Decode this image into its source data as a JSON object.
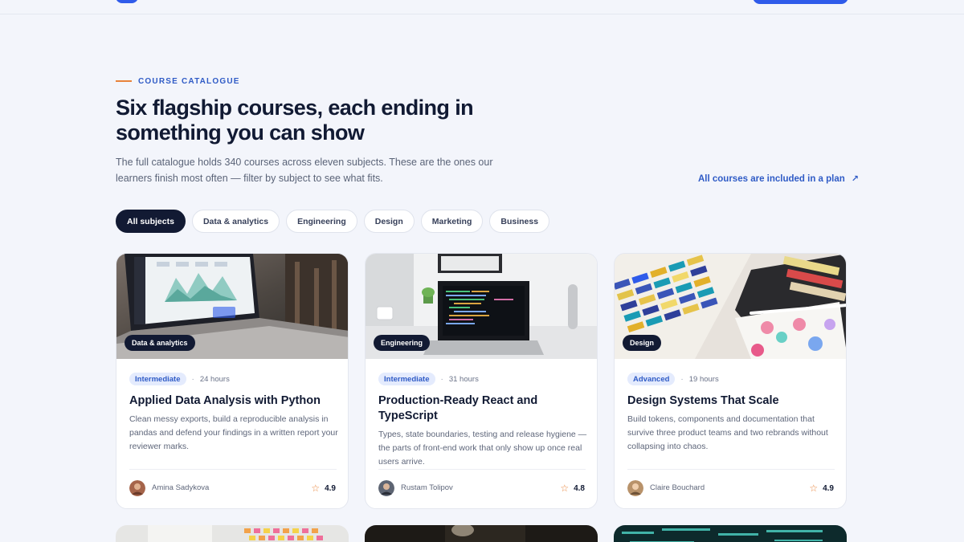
{
  "section": {
    "eyebrow": "COURSE CATALOGUE",
    "headline": "Six flagship courses, each ending in something you can show",
    "lede": "The full catalogue holds 340 courses across eleven subjects. These are the ones our learners finish most often — filter by subject to see what fits.",
    "plan_link": "All courses are included in a plan",
    "plan_link_icon": "arrow-up-right-icon"
  },
  "filters": [
    "All subjects",
    "Data & analytics",
    "Engineering",
    "Design",
    "Marketing",
    "Business"
  ],
  "active_filter": "All subjects",
  "courses": [
    {
      "subject": "Data & analytics",
      "level": "Intermediate",
      "duration": "24 hours",
      "title": "Applied Data Analysis with Python",
      "description": "Clean messy exports, build a reproducible analysis in pandas and defend your findings in a written report your reviewer marks.",
      "instructor": "Amina Sadykova",
      "rating": "4.9"
    },
    {
      "subject": "Engineering",
      "level": "Intermediate",
      "duration": "31 hours",
      "title": "Production-Ready React and TypeScript",
      "description": "Types, state boundaries, testing and release hygiene — the parts of front-end work that only show up once real users arrive.",
      "instructor": "Rustam Tolipov",
      "rating": "4.8"
    },
    {
      "subject": "Design",
      "level": "Advanced",
      "duration": "19 hours",
      "title": "Design Systems That Scale",
      "description": "Build tokens, components and documentation that survive three product teams and two rebrands without collapsing into chaos.",
      "instructor": "Claire Bouchard",
      "rating": "4.9"
    }
  ],
  "colors": {
    "accent": "#2f5bea",
    "eyebrow_line": "#e8833a",
    "chip_active": "#121a33",
    "level_bg": "#e4ebfd"
  }
}
